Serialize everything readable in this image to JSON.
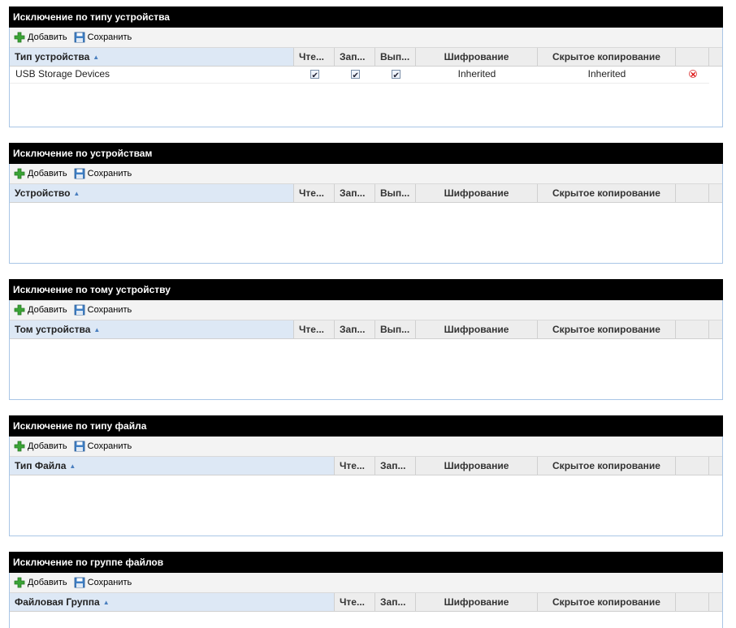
{
  "toolbar": {
    "add_label": "Добавить",
    "save_label": "Сохранить"
  },
  "panels": [
    {
      "title": "Исключение по типу устройства",
      "columns": [
        "Тип устройства",
        "Чте...",
        "Зап...",
        "Вып...",
        "Шифрование",
        "Скрытое копирование"
      ],
      "rows": [
        {
          "name": "USB Storage Devices",
          "read": true,
          "write": true,
          "exec": true,
          "encryption": "Inherited",
          "shadow": "Inherited"
        }
      ]
    },
    {
      "title": "Исключение по устройствам",
      "columns": [
        "Устройство",
        "Чте...",
        "Зап...",
        "Вып...",
        "Шифрование",
        "Скрытое копирование"
      ],
      "rows": []
    },
    {
      "title": "Исключение по тому устройству",
      "columns": [
        "Том устройства",
        "Чте...",
        "Зап...",
        "Вып...",
        "Шифрование",
        "Скрытое копирование"
      ],
      "rows": []
    },
    {
      "title": "Исключение по типу файла",
      "columns": [
        "Тип Файла",
        "Чте...",
        "Зап...",
        "Шифрование",
        "Скрытое копирование"
      ],
      "rows": []
    },
    {
      "title": "Исключение по группе файлов",
      "columns": [
        "Файловая Группа",
        "Чте...",
        "Зап...",
        "Шифрование",
        "Скрытое копирование"
      ],
      "rows": []
    }
  ]
}
